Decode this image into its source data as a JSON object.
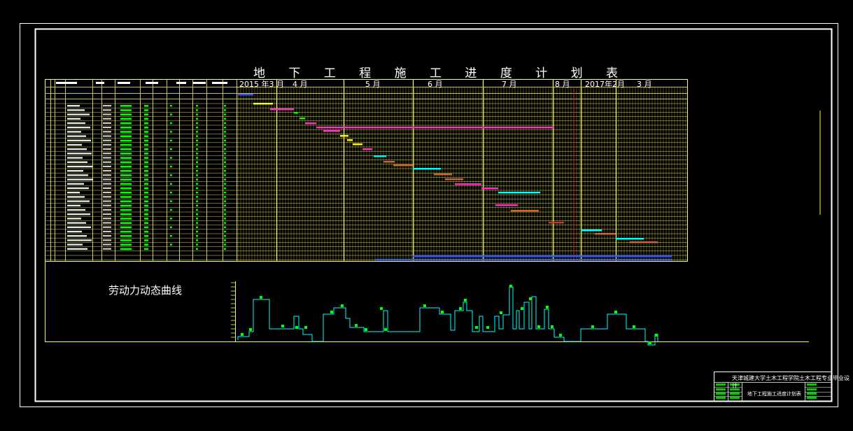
{
  "title": "地 下 工 程 施 工 进 度 计 划 表",
  "labor_curve_title": "劳动力动态曲线",
  "month_headers": [
    "2015 年3 月",
    "4 月",
    "5 月",
    "6 月",
    "7 月",
    "8 月",
    "2017年2月",
    "3 月"
  ],
  "title_block": {
    "school": "天津城建大学土木工程学院土木工程专业毕业设计",
    "drawing_name": "地下工程施工进度计划表"
  },
  "colors": {
    "frame": "#ffffff",
    "grid": "#ffff66",
    "axis": "#ffff00",
    "curve": "#00ffff",
    "marker": "#00ff00",
    "bar_blue": "#3355ff",
    "bar_magenta": "#ff33cc",
    "bar_yellow": "#ffff00",
    "bar_brown": "#cc6633",
    "bar_red": "#cc3333",
    "tb_green": "#00cc00"
  }
}
